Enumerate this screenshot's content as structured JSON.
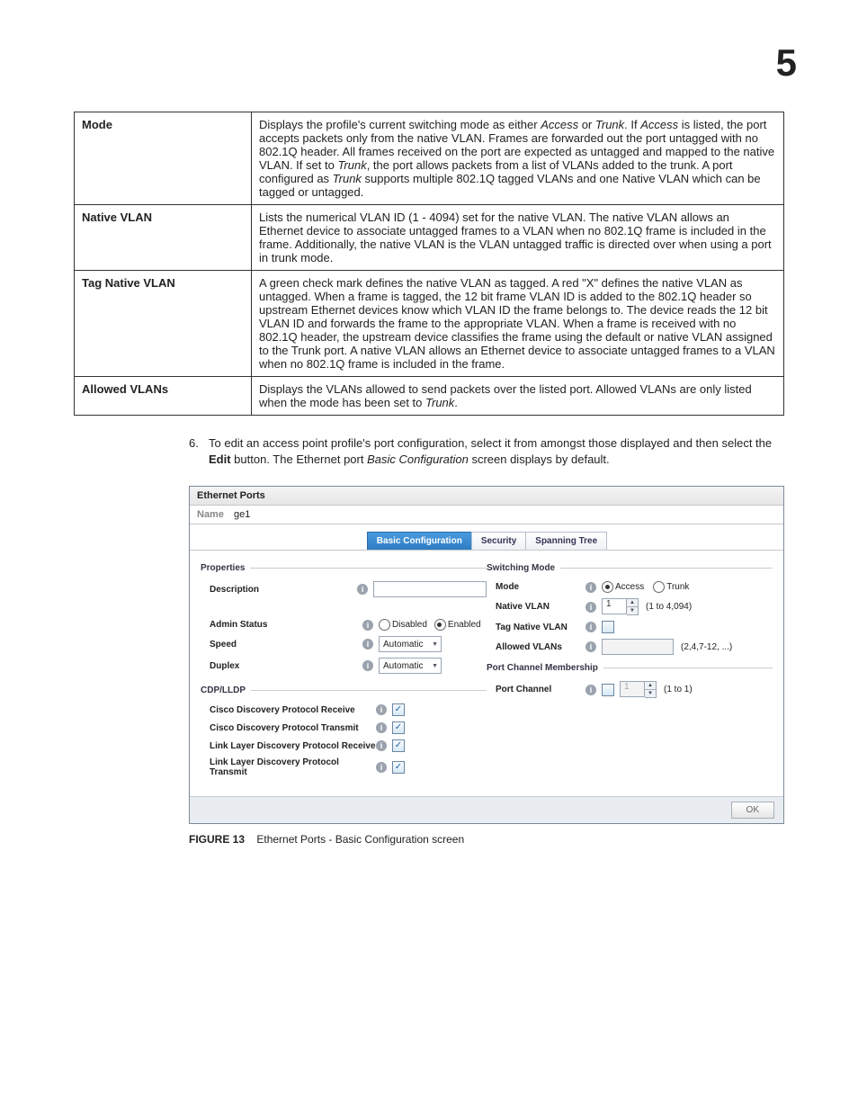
{
  "page_number": "5",
  "table": [
    {
      "term": "Mode",
      "desc_html": "Displays the profile's current switching mode as either <em>Access</em> or <em>Trunk</em>. If <em>Access</em> is listed, the port accepts packets only from the native VLAN. Frames are forwarded out the port untagged with no 802.1Q header. All frames received on the port are expected as untagged and mapped to the native VLAN. If set to <em>Trunk</em>, the port allows packets from a list of VLANs added to the trunk. A port configured as <em>Trunk</em> supports multiple 802.1Q tagged VLANs and one Native VLAN which can be tagged or untagged."
    },
    {
      "term": "Native VLAN",
      "desc_html": "Lists the numerical VLAN ID (1 - 4094) set for the native VLAN. The native VLAN allows an Ethernet device to associate untagged frames to a VLAN when no 802.1Q frame is included in the frame. Additionally, the native VLAN is the VLAN untagged traffic is directed over when using a port in trunk mode."
    },
    {
      "term": "Tag Native VLAN",
      "desc_html": "A green check mark defines the native VLAN as tagged. A red \"X\" defines the native VLAN as untagged. When a frame is tagged, the 12 bit frame VLAN ID is added to the 802.1Q header so upstream Ethernet devices know which VLAN ID the frame belongs to. The device reads the 12 bit VLAN ID and forwards the frame to the appropriate VLAN. When a frame is received with no 802.1Q header, the upstream device classifies the frame using the default or native VLAN assigned to the Trunk port. A native VLAN allows an Ethernet device to associate untagged frames to a VLAN when no 802.1Q frame is included in the frame."
    },
    {
      "term": "Allowed VLANs",
      "desc_html": "Displays the VLANs allowed to send packets over the listed port. Allowed VLANs are only listed when the mode has been set to <em>Trunk</em>."
    }
  ],
  "step": {
    "num": "6.",
    "text_html": "To edit an access point profile's port configuration, select it from amongst those displayed and then select the <strong>Edit</strong> button. The Ethernet port <em>Basic Configuration</em> screen displays by default."
  },
  "ui": {
    "title": "Ethernet Ports",
    "name_label": "Name",
    "name_value": "ge1",
    "tabs": {
      "basic": "Basic Configuration",
      "security": "Security",
      "spanning": "Spanning Tree"
    },
    "properties": {
      "section": "Properties",
      "description": "Description",
      "admin_status": "Admin Status",
      "disabled": "Disabled",
      "enabled": "Enabled",
      "speed": "Speed",
      "duplex": "Duplex",
      "auto": "Automatic"
    },
    "cdp": {
      "section": "CDP/LLDP",
      "rx": "Cisco Discovery Protocol Receive",
      "tx": "Cisco Discovery Protocol Transmit",
      "lldp_rx": "Link Layer Discovery Protocol Receive",
      "lldp_tx": "Link Layer Discovery Protocol Transmit"
    },
    "switch": {
      "section": "Switching Mode",
      "mode": "Mode",
      "access": "Access",
      "trunk": "Trunk",
      "native": "Native VLAN",
      "native_val": "1",
      "native_range": "(1 to 4,094)",
      "tag_native": "Tag Native VLAN",
      "allowed": "Allowed VLANs",
      "allowed_hint": "(2,4,7-12, ...)"
    },
    "portch": {
      "section": "Port Channel Membership",
      "label": "Port Channel",
      "val": "1",
      "range": "(1 to 1)"
    },
    "ok": "OK"
  },
  "figure": {
    "num": "FIGURE 13",
    "caption": "Ethernet Ports - Basic Configuration screen"
  }
}
